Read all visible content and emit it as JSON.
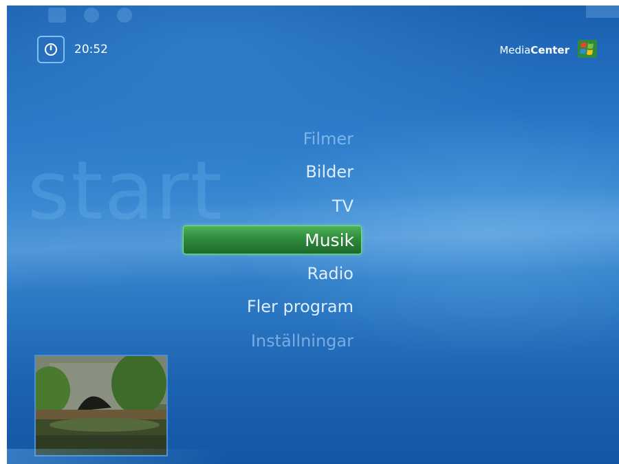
{
  "header": {
    "clock": "20:52",
    "brand_light": "Media",
    "brand_bold": "Center"
  },
  "watermark": "start",
  "menu": {
    "items": [
      {
        "label": "Filmer",
        "state": "faded"
      },
      {
        "label": "Bilder",
        "state": "normal"
      },
      {
        "label": "TV",
        "state": "normal"
      },
      {
        "label": "Musik",
        "state": "selected"
      },
      {
        "label": "Radio",
        "state": "normal"
      },
      {
        "label": "Fler program",
        "state": "normal"
      },
      {
        "label": "Inställningar",
        "state": "faded"
      }
    ]
  },
  "colors": {
    "background": "#2a78c8",
    "selection": "#2f8a3c",
    "text": "#ddeeff"
  },
  "icons": {
    "power": "power-icon",
    "windows": "windows-logo-icon"
  }
}
